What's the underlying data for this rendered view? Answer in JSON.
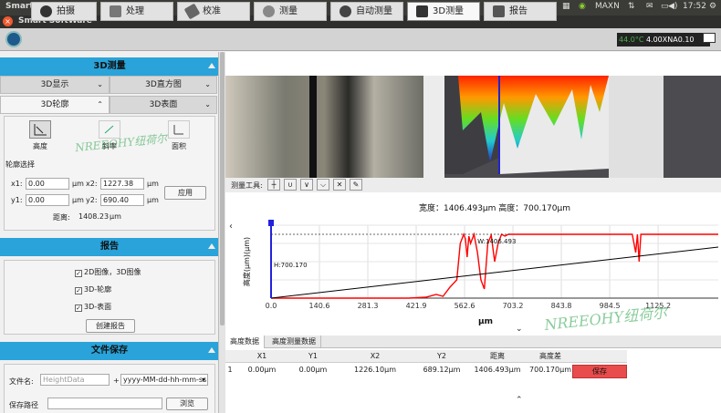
{
  "system_bar": {
    "app_name": "Smart SoftWare",
    "network_name": "MAXN",
    "time": "17:52",
    "sound": "◀)",
    "battery": "▭",
    "mail": "✉",
    "wifi": "⇅",
    "bt": "⚙"
  },
  "window_bar": {
    "title": "Smart SoftWare",
    "close": "×"
  },
  "toolbar": {
    "items": [
      {
        "label": "拍摄",
        "icon": "camera-icon"
      },
      {
        "label": "处理",
        "icon": "image-process-icon"
      },
      {
        "label": "校准",
        "icon": "ruler-icon"
      },
      {
        "label": "测量",
        "icon": "measure-icon"
      },
      {
        "label": "自动测量",
        "icon": "auto-measure-icon"
      },
      {
        "label": "3D测量",
        "icon": "3d-icon"
      },
      {
        "label": "报告",
        "icon": "report-icon"
      }
    ],
    "status_temp": "44.0°C",
    "status_obj": "4.00XNA0.10"
  },
  "left": {
    "section_3d": "3D测量",
    "combo_3d_display": "3D显示",
    "combo_3d_hist": "3D直方图",
    "combo_3d_profile": "3D轮廓",
    "combo_3d_surface": "3D表面",
    "meas_height": "高度",
    "meas_slope": "斜率",
    "meas_area": "面积",
    "profile_select": "轮廓选择",
    "x1_label": "x1:",
    "x1_value": "0.00",
    "unit_um": "µm",
    "x2_label": "x2:",
    "x2_value": "1227.38",
    "y1_label": "y1:",
    "y1_value": "0.00",
    "y2_label": "y2:",
    "y2_value": "690.40",
    "apply": "应用",
    "distance_label": "距离:",
    "distance_value": "1408.23",
    "distance_unit": "µm",
    "section_report": "报告",
    "chk_2d3d": "2D图像，3D图像",
    "chk_profile": "3D-轮廓",
    "chk_surface": "3D-表面",
    "create_report": "创建报告",
    "section_save": "文件保存",
    "file_name_label": "文件名:",
    "file_name_placeholder": "HeightData",
    "plus": "+",
    "date_format": "yyyy-MM-dd-hh-mm-ss",
    "path_label": "保存路径",
    "browse": "浏览"
  },
  "meas_tools": {
    "label": "测量工具:"
  },
  "chart_data": {
    "type": "line",
    "title": "宽度：1406.493µm 高度：700.170µm",
    "xlabel": "µm",
    "ylabel": "高度(µm)(µm)",
    "xlim": [
      0,
      1300
    ],
    "ylim": [
      0,
      800
    ],
    "x_ticks": [
      "0.0",
      "140.6",
      "281.3",
      "421.9",
      "562.6",
      "703.2",
      "843.8",
      "984.5",
      "1125.2"
    ],
    "annotation_w": "W:1406.493",
    "annotation_h": "H:700.170",
    "series": [
      {
        "color": "#ff0000",
        "x": [
          0,
          100,
          200,
          300,
          400,
          450,
          480,
          500,
          520,
          540,
          550,
          560,
          565,
          570,
          575,
          580,
          590,
          600,
          610,
          620,
          630,
          640,
          650,
          660,
          670,
          680,
          690,
          700,
          800,
          900,
          1000,
          1050,
          1060,
          1065,
          1070,
          1075,
          1080,
          1090,
          1100,
          1200,
          1300
        ],
        "y": [
          0,
          0,
          0,
          0,
          0,
          10,
          40,
          20,
          120,
          200,
          600,
          700,
          650,
          450,
          680,
          600,
          700,
          500,
          200,
          100,
          600,
          690,
          400,
          600,
          700,
          680,
          700,
          700,
          700,
          700,
          700,
          700,
          500,
          700,
          400,
          700,
          700,
          700,
          700,
          700,
          700
        ]
      },
      {
        "color": "#000000",
        "x": [
          0,
          1300
        ],
        "y": [
          0,
          560
        ]
      }
    ]
  },
  "tabs": {
    "tab1": "高度数据",
    "tab2": "高度测量数据"
  },
  "table": {
    "headers": [
      "X1",
      "Y1",
      "X2",
      "Y2",
      "距离",
      "高度差"
    ],
    "row_index": "1",
    "row": [
      "0.00µm",
      "0.00µm",
      "1226.10µm",
      "689.12µm",
      "1406.493µm",
      "700.170µm"
    ],
    "save": "保存"
  },
  "watermark": "NREEOHY纽荷尔"
}
